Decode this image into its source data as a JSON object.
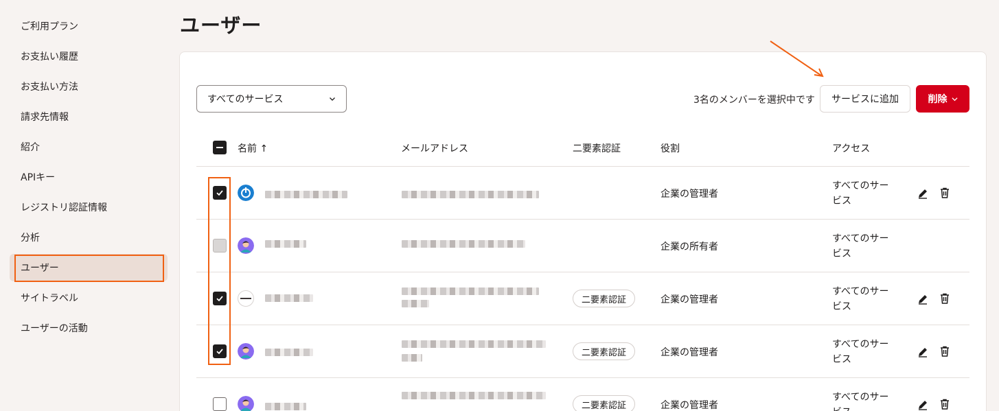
{
  "sidebar": {
    "items": [
      {
        "label": "ご利用プラン"
      },
      {
        "label": "お支払い履歴"
      },
      {
        "label": "お支払い方法"
      },
      {
        "label": "請求先情報"
      },
      {
        "label": "紹介"
      },
      {
        "label": "APIキー"
      },
      {
        "label": "レジストリ認証情報"
      },
      {
        "label": "分析"
      },
      {
        "label": "ユーザー",
        "active": true
      },
      {
        "label": "サイトラベル"
      },
      {
        "label": "ユーザーの活動"
      }
    ]
  },
  "page": {
    "title": "ユーザー"
  },
  "toolbar": {
    "filter_value": "すべてのサービス",
    "selected_count": "3名のメンバーを選択中です",
    "add_label": "サービスに追加",
    "delete_label": "削除"
  },
  "table": {
    "headers": {
      "name": "名前 ↑",
      "email": "メールアドレス",
      "twofa": "二要素認証",
      "role": "役割",
      "access": "アクセス"
    },
    "rows": [
      {
        "checked": "checked",
        "twofa": "",
        "role": "企業の管理者",
        "access": "すべてのサービス",
        "actions": true
      },
      {
        "checked": "disabled",
        "twofa": "",
        "role": "企業の所有者",
        "access": "すべてのサービス",
        "actions": false
      },
      {
        "checked": "checked",
        "twofa": "二要素認証",
        "role": "企業の管理者",
        "access": "すべてのサービス",
        "actions": true
      },
      {
        "checked": "checked",
        "twofa": "二要素認証",
        "role": "企業の管理者",
        "access": "すべてのサービス",
        "actions": true
      },
      {
        "checked": "empty",
        "twofa": "二要素認証",
        "role": "企業の管理者",
        "access": "すべてのサービス",
        "actions": true
      }
    ]
  },
  "colors": {
    "accent": "#d4001a",
    "annotation": "#f06012",
    "sidebar_active": "#ebddd6"
  },
  "icons": [
    "check-icon",
    "chevron-down-icon",
    "edit-icon",
    "trash-icon",
    "power-icon",
    "arrow-annotation-icon"
  ]
}
